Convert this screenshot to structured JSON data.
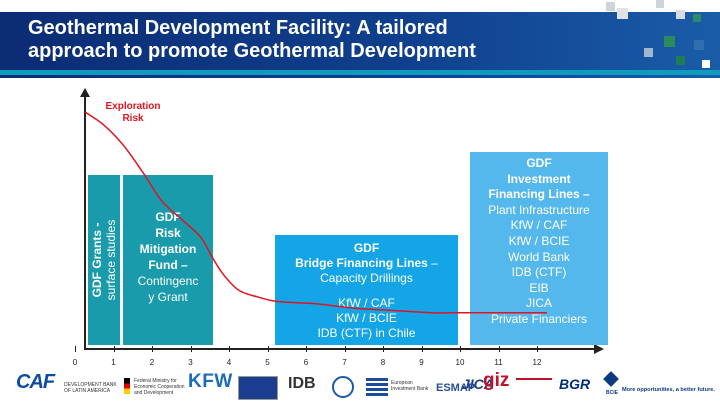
{
  "header": {
    "title_line1": "Geothermal Development Facility: A tailored",
    "title_line2": "approach to promote Geothermal Development",
    "colors": {
      "navy": "#0c2c74",
      "band": "#0e9bbf"
    }
  },
  "chart_data": {
    "type": "line",
    "x_ticks": [
      "0",
      "1",
      "2",
      "3",
      "4",
      "5",
      "6",
      "7",
      "8",
      "9",
      "10",
      "11",
      "12"
    ],
    "series": [
      {
        "name": "Exploration Risk",
        "color": "#e0141f",
        "x": [
          0,
          0.5,
          1,
          1.5,
          2,
          2.5,
          3,
          3.3,
          3.6,
          4,
          4.5,
          5,
          6,
          7,
          8,
          9,
          10,
          11,
          12
        ],
        "y": [
          1.0,
          0.94,
          0.85,
          0.73,
          0.6,
          0.52,
          0.44,
          0.35,
          0.27,
          0.2,
          0.17,
          0.15,
          0.14,
          0.12,
          0.11,
          0.1,
          0.1,
          0.1,
          0.1
        ]
      }
    ],
    "label": "Exploration\nRisk",
    "grid": false
  },
  "boxes": {
    "grants": {
      "line1": "GDF Grants  -",
      "line2": "surface studies"
    },
    "fund": {
      "l1": "GDF",
      "l2": "Risk",
      "l3": "Mitigation",
      "l4": "Fund –",
      "l5": "Contingenc",
      "l6": "y Grant"
    },
    "bridge": {
      "l1": "GDF",
      "l2": "Bridge Financing Lines",
      "l2_suffix": " –",
      "l3": "Capacity Drillings",
      "items": [
        "KfW / CAF",
        "KfW / BCIE",
        "IDB (CTF) in Chile"
      ]
    },
    "investment": {
      "l1": "GDF",
      "l2": "Investment",
      "l3": "Financing Lines –",
      "l4": "Plant Infrastructure",
      "items": [
        "KfW / CAF",
        "KfW / BCIE",
        "World Bank",
        "IDB (CTF)",
        "EIB",
        "JICA",
        "Private Financiers"
      ]
    }
  },
  "footer": {
    "caf": "CAF",
    "caf_sub": "DEVELOPMENT BANK OF LATIN AMERICA",
    "bmz": "Federal Ministry for Economic Cooperation and Development",
    "kfw": "KFW",
    "idb": "IDB",
    "eib": "European Investment Bank",
    "esmap": "ESMAP",
    "jica": "JICA",
    "giz": "giz",
    "bgr": "BGR",
    "bcie": "BCIE",
    "tagline": "More opportunities, a better future."
  }
}
